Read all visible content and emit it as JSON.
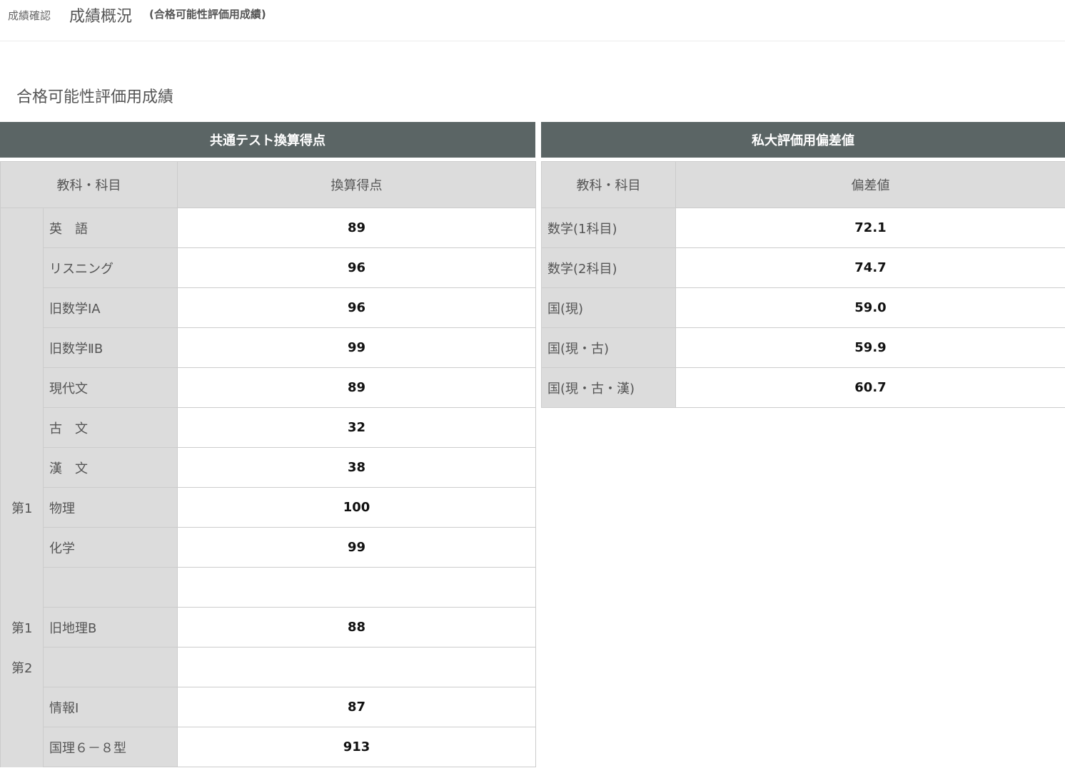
{
  "header": {
    "breadcrumb": "成績確認",
    "title": "成績概況",
    "subtitle": "(合格可能性評価用成績)"
  },
  "section_title": "合格可能性評価用成績",
  "left": {
    "band": "共通テスト換算得点",
    "col_subject": "教科・科目",
    "col_score": "換算得点",
    "group_labels": [
      "第1",
      "第1",
      "第2"
    ],
    "rows": [
      {
        "subject": "英　語",
        "score": "89"
      },
      {
        "subject": "リスニング",
        "score": "96"
      },
      {
        "subject": "旧数学ⅠA",
        "score": "96"
      },
      {
        "subject": "旧数学ⅡB",
        "score": "99"
      },
      {
        "subject": "現代文",
        "score": "89"
      },
      {
        "subject": "古　文",
        "score": "32"
      },
      {
        "subject": "漢　文",
        "score": "38"
      },
      {
        "subject": "物理",
        "score": "100"
      },
      {
        "subject": "化学",
        "score": "99"
      },
      {
        "subject": "",
        "score": ""
      },
      {
        "subject": "旧地理B",
        "score": "88"
      },
      {
        "subject": "",
        "score": ""
      },
      {
        "subject": "情報Ⅰ",
        "score": "87"
      },
      {
        "subject": "国理６－８型",
        "score": "913"
      }
    ]
  },
  "right": {
    "band": "私大評価用偏差値",
    "col_subject": "教科・科目",
    "col_value": "偏差値",
    "rows": [
      {
        "subject": "数学(1科目)",
        "value": "72.1"
      },
      {
        "subject": "数学(2科目)",
        "value": "74.7"
      },
      {
        "subject": "国(現)",
        "value": "59.0"
      },
      {
        "subject": "国(現・古)",
        "value": "59.9"
      },
      {
        "subject": "国(現・古・漢)",
        "value": "60.7"
      }
    ]
  }
}
